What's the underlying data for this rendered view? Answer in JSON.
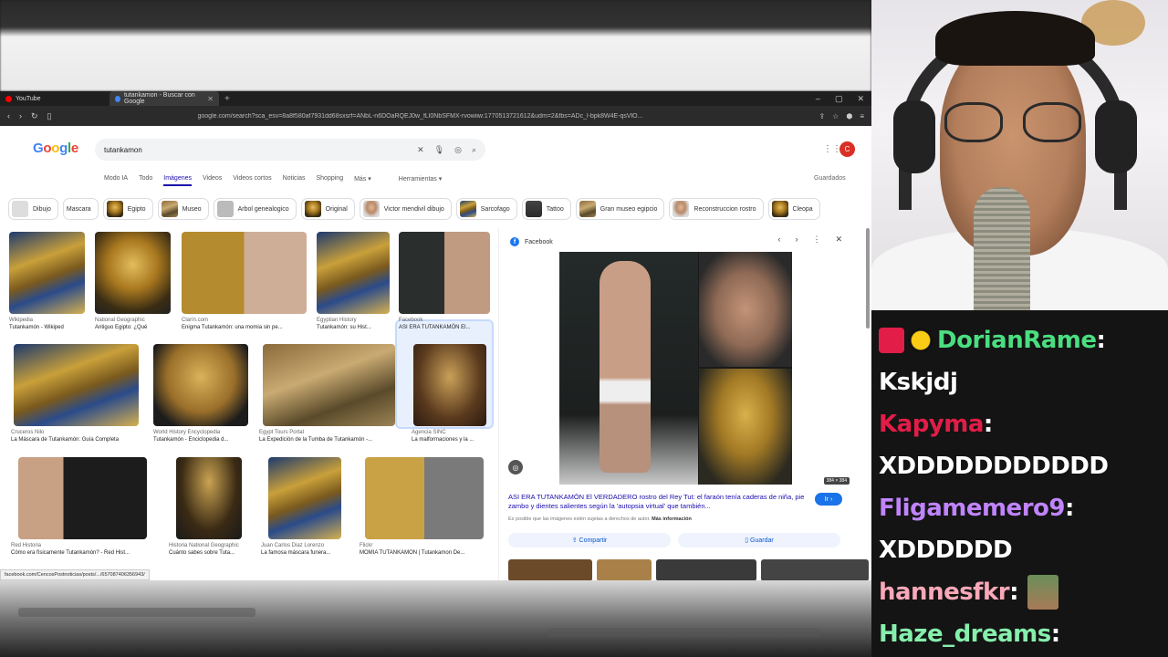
{
  "browser": {
    "tabs": [
      {
        "label": "YouTube",
        "color": "#ff0000"
      },
      {
        "label": "tutankamon - Buscar con Google",
        "color": "#4285f4"
      }
    ],
    "url": "google.com/search?sca_esv=8a8f580af7931dd68sxsrf=ANbL-n6DOaRQEJ0w_fLl0NbSFMX-rvowiiw:1770513721612&udm=2&fbs=ADc_l-bpk8W4E-qsVlO...",
    "status_url": "facebook.com/CencosPostnoticias/posts/.../657087406356943/"
  },
  "google": {
    "logo": "Google",
    "query": "tutankamon",
    "nav_tabs": [
      "Modo IA",
      "Todo",
      "Imágenes",
      "Videos",
      "Videos cortos",
      "Noticias",
      "Shopping",
      "Más ▾"
    ],
    "active_tab": "Imágenes",
    "tools": "Herramientas ▾",
    "saved": "Guardados",
    "avatar": "C",
    "chips": [
      "Dibujo",
      "Mascara",
      "Egipto",
      "Museo",
      "Arbol genealogico",
      "Original",
      "Victor mendivil dibujo",
      "Sarcofago",
      "Tattoo",
      "Gran museo egipcio",
      "Reconstruccion rostro",
      "Cleopa"
    ]
  },
  "results": [
    {
      "source": "Wikipedia",
      "title": "Tutankamón - Wikiped"
    },
    {
      "source": "National Geographic",
      "title": "Antiguo Egipto: ¿Qué"
    },
    {
      "source": "Clarín.com",
      "title": "Enigma Tutankamón: una momia sin pe..."
    },
    {
      "source": "Egyptian History",
      "title": "Tutankamón: su Hist..."
    },
    {
      "source": "Facebook",
      "title": "ASI ERA TUTANKAMÓN El..."
    },
    {
      "source": "Cruceros Nilo",
      "title": "La Máscara de Tutankamón: Guía Completa"
    },
    {
      "source": "World History Encyclopedia",
      "title": "Tutankamón - Enciclopedia d..."
    },
    {
      "source": "Egypt Tours Portal",
      "title": "La Expedición de la Tumba de Tutankamón -..."
    },
    {
      "source": "Agencia SINC",
      "title": "La malformaciones y la ..."
    },
    {
      "source": "Red Historia",
      "title": "Cómo era físicamente Tutankamón? - Red Hist..."
    },
    {
      "source": "Historia National Geographic",
      "title": "Cuánto sabes sobre Tuta..."
    },
    {
      "source": "Juan Carlos Diaz Lorenzo",
      "title": "La famosa máscara funera..."
    },
    {
      "source": "Flickr",
      "title": "MOMIA TUTANKAMON | Tutankamon De..."
    }
  ],
  "panel": {
    "source": "Facebook",
    "dims": "384 × 384",
    "title": "ASI ERA TUTANKAMÓN El VERDADERO rostro del Rey Tut: el faraón tenía caderas de niña, pie zambo y dientes salientes según la 'autopsia virtual' que también...",
    "note": "Es posible que las imágenes estén sujetas a derechos de autor.",
    "note_link": "Más información",
    "go": "Ir ›",
    "share": "Compartir",
    "save": "Guardar"
  },
  "chat": [
    {
      "user": "DorianRame",
      "color": "#4ade80",
      "badges": true,
      "msg": "Kskjdj"
    },
    {
      "user": "Kapyma",
      "color": "#e11d48",
      "badges": false,
      "msg": "XDDDDDDDDDDD"
    },
    {
      "user": "Fligamemero9",
      "color": "#c084fc",
      "badges": false,
      "msg": "XDDDDDD"
    },
    {
      "user": "hannesfkr",
      "color": "#f9a8b8",
      "badges": false,
      "msg": ""
    },
    {
      "user": "Haze_dreams",
      "color": "#86efac",
      "badges": false,
      "msg": ""
    }
  ]
}
